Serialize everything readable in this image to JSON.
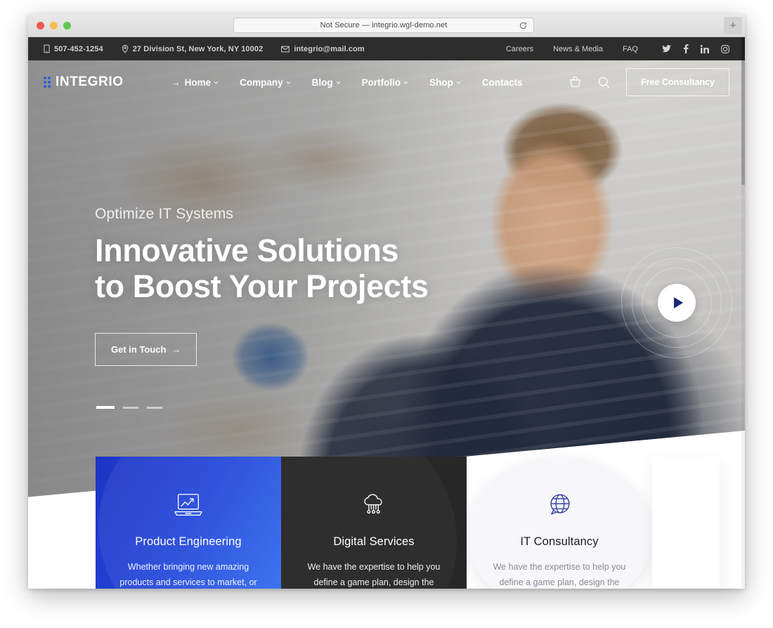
{
  "browser": {
    "url_text": "Not Secure — integrio.wgl-demo.net",
    "reload_icon": "reload-icon",
    "new_tab_label": "+"
  },
  "topbar": {
    "phone": "507-452-1254",
    "address": "27 Division St, New York, NY 10002",
    "email": "integrio@mail.com",
    "links": [
      {
        "label": "Careers"
      },
      {
        "label": "News & Media"
      },
      {
        "label": "FAQ"
      }
    ],
    "socials": [
      {
        "name": "twitter-icon"
      },
      {
        "name": "facebook-icon"
      },
      {
        "name": "linkedin-icon"
      },
      {
        "name": "instagram-icon"
      }
    ]
  },
  "nav": {
    "logo_text": "INTEGRIO",
    "logo_color": "#2f5fd8",
    "items": [
      {
        "label": "Home",
        "has_caret": true,
        "has_arrow": true
      },
      {
        "label": "Company",
        "has_caret": true,
        "has_arrow": false
      },
      {
        "label": "Blog",
        "has_caret": true,
        "has_arrow": false
      },
      {
        "label": "Portfolio",
        "has_caret": true,
        "has_arrow": false
      },
      {
        "label": "Shop",
        "has_caret": true,
        "has_arrow": false
      },
      {
        "label": "Contacts",
        "has_caret": false,
        "has_arrow": false
      }
    ],
    "cart_icon": "cart-icon",
    "search_icon": "search-icon",
    "cta_label": "Free Consultancy"
  },
  "hero": {
    "subtitle": "Optimize IT Systems",
    "title": "Innovative Solutions\nto Boost Your Projects",
    "button_label": "Get in Touch",
    "button_arrow": "→",
    "play_button": "play-button",
    "slides": [
      {
        "active": true
      },
      {
        "active": false
      },
      {
        "active": false
      }
    ]
  },
  "cards": [
    {
      "icon": "laptop-chart-icon",
      "title": "Product Engineering",
      "desc": "Whether bringing new amazing products and services to market, or discovering new ways.",
      "theme": "blue"
    },
    {
      "icon": "cloud-network-icon",
      "title": "Digital Services",
      "desc": "We have the expertise to help you define a game plan, design the products customers want.",
      "theme": "dark"
    },
    {
      "icon": "globe-chat-icon",
      "title": "IT Consultancy",
      "desc": "We have the expertise to help you define a game plan, design the products customers want.",
      "theme": "light"
    }
  ]
}
